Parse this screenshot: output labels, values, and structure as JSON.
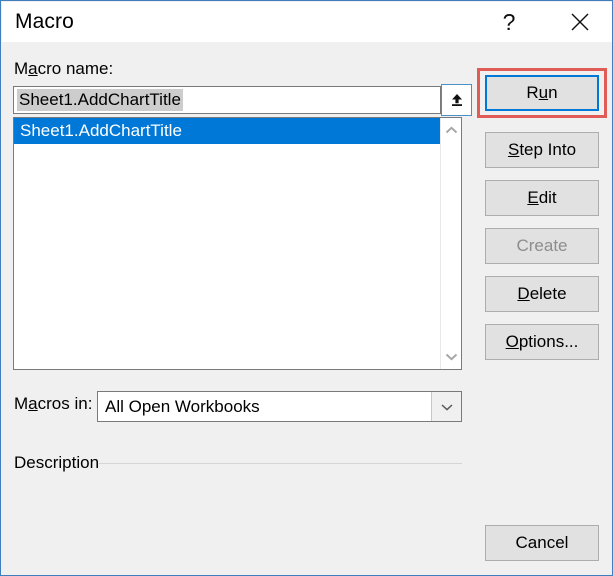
{
  "window": {
    "title": "Macro",
    "help_icon": "question-mark-icon",
    "close_icon": "close-x-icon"
  },
  "form": {
    "macro_name_label_pre": "M",
    "macro_name_label_accel": "a",
    "macro_name_label_post": "cro name:",
    "macro_name_label": "Macro name:",
    "macro_name_value": "Sheet1.AddChartTitle",
    "macro_name_placeholder": "",
    "spinner_icon": "up-arrow-icon",
    "macros_in_label_pre": "M",
    "macros_in_label_accel": "a",
    "macros_in_label_post": "cros in:",
    "macros_in_label": "Macros in:",
    "macros_in_value": "All Open Workbooks",
    "macros_in_options": [
      "All Open Workbooks"
    ],
    "combo_icon": "chevron-down-icon",
    "description_label": "Description",
    "description_value": ""
  },
  "list": {
    "items": [
      {
        "label": "Sheet1.AddChartTitle",
        "selected": true
      }
    ],
    "scroll_up_icon": "chevron-up-icon",
    "scroll_down_icon": "chevron-down-icon"
  },
  "buttons": {
    "run": {
      "pre": "R",
      "accel": "u",
      "post": "n",
      "label": "Run"
    },
    "step_into": {
      "pre": "",
      "accel": "S",
      "post": "tep Into",
      "label": "Step Into"
    },
    "edit": {
      "pre": "",
      "accel": "E",
      "post": "dit",
      "label": "Edit"
    },
    "create": {
      "pre": "Create",
      "accel": "",
      "post": "",
      "label": "Create"
    },
    "delete": {
      "pre": "",
      "accel": "D",
      "post": "elete",
      "label": "Delete"
    },
    "options": {
      "pre": "",
      "accel": "O",
      "post": "ptions...",
      "label": "Options..."
    },
    "cancel": {
      "pre": "Cancel",
      "accel": "",
      "post": "",
      "label": "Cancel"
    }
  },
  "colors": {
    "accent": "#0078d7",
    "selection": "#0078d7",
    "highlight_annotation": "#e05c56",
    "dialog_border": "#3f7fbf",
    "body_background": "#f0f0f0",
    "button_face": "#e1e1e1",
    "disabled_text": "#8d8d8d",
    "text_selection": "#cdcdcd"
  }
}
